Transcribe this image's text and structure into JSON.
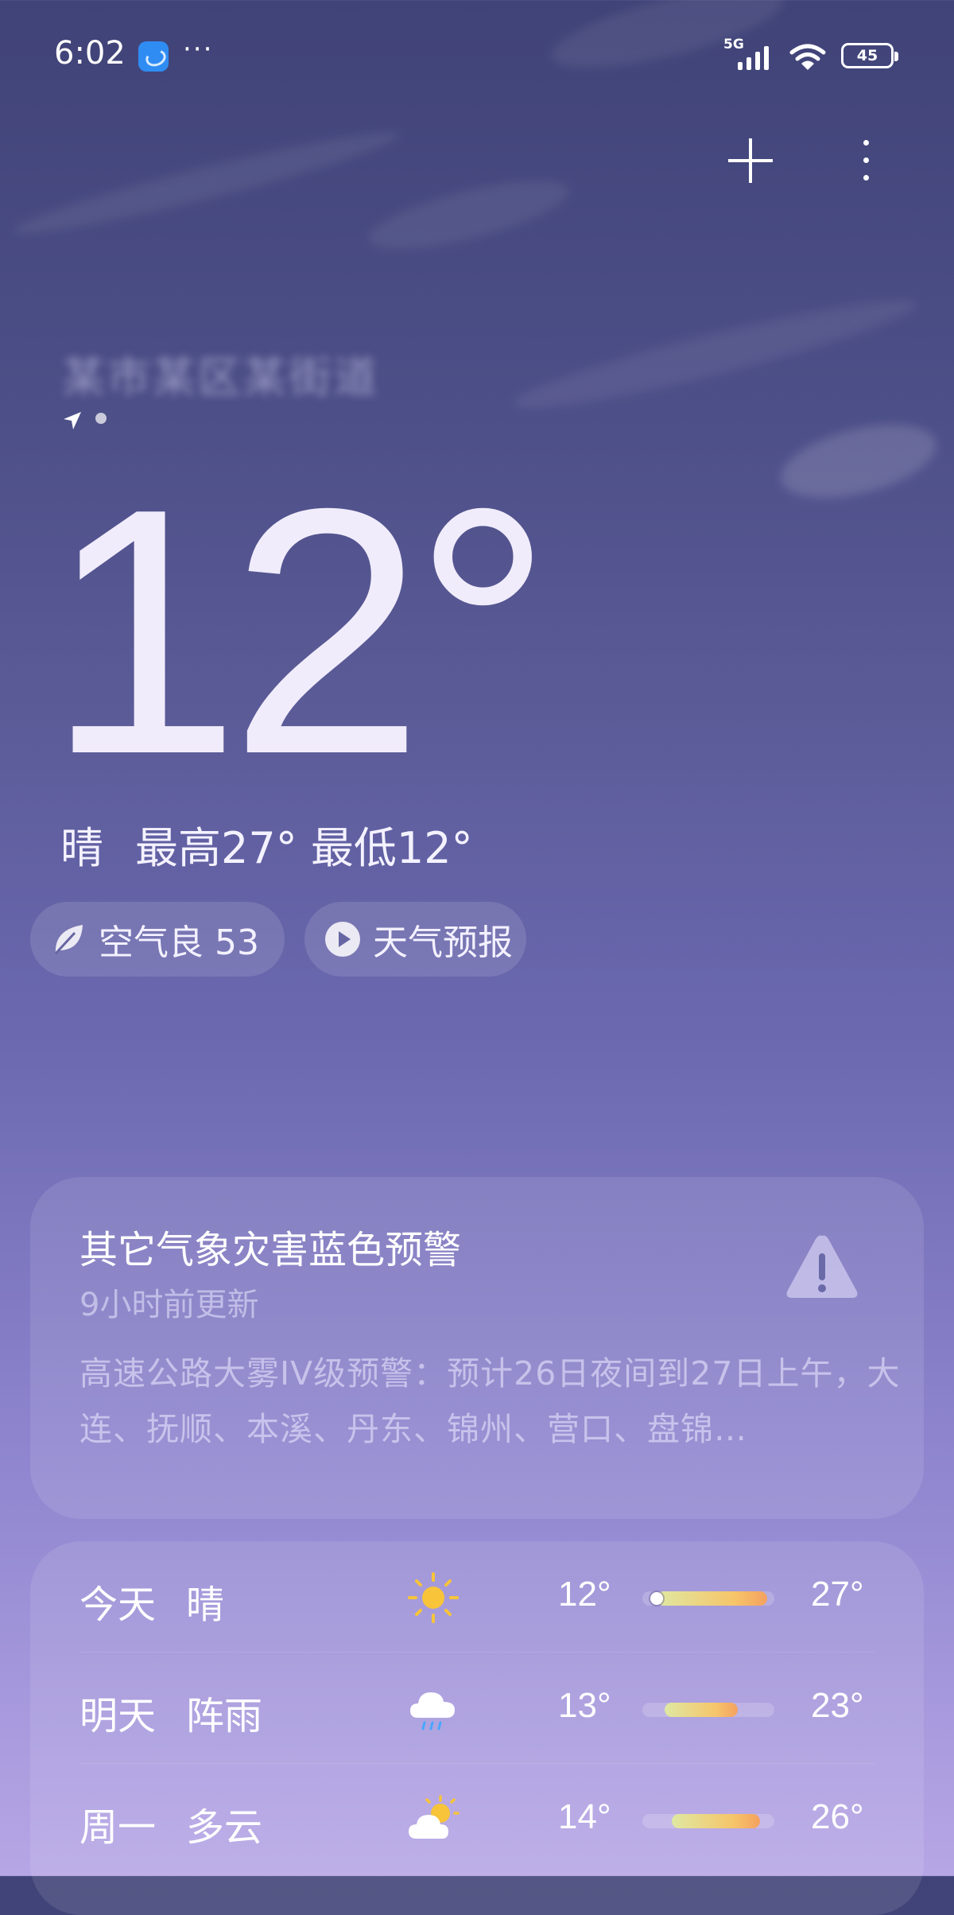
{
  "status_bar": {
    "time": "6:02",
    "app_icon": "weather-app-icon",
    "more": "···",
    "network": "5G",
    "battery": "45"
  },
  "header": {
    "add_icon": "plus-icon",
    "menu_icon": "vertical-ellipsis-icon"
  },
  "location": {
    "name": "某市某区某街道",
    "indicator_icon": "location-arrow-icon"
  },
  "current": {
    "temperature": "12°",
    "condition": "晴",
    "high_label": "最高27°",
    "low_label": "最低12°"
  },
  "chips": {
    "aqi": "空气良 53",
    "aqi_icon": "leaf-icon",
    "forecast": "天气预报",
    "forecast_icon": "play-icon"
  },
  "alert": {
    "title": "其它气象灾害蓝色预警",
    "updated": "9小时前更新",
    "text": "高速公路大雾IV级预警：预计26日夜间到27日上午，大连、抚顺、本溪、丹东、锦州、营口、盘锦…",
    "icon": "warning-triangle-icon"
  },
  "forecast": [
    {
      "day": "今天",
      "condition": "晴",
      "icon": "sun-icon",
      "low": "12°",
      "high": "27°",
      "low_val": 12,
      "high_val": 27,
      "now_val": 12
    },
    {
      "day": "明天",
      "condition": "阵雨",
      "icon": "rain-cloud-icon",
      "low": "13°",
      "high": "23°",
      "low_val": 13,
      "high_val": 23
    },
    {
      "day": "周一",
      "condition": "多云",
      "icon": "partly-cloudy-icon",
      "low": "14°",
      "high": "26°",
      "low_val": 14,
      "high_val": 26
    }
  ],
  "colors": {
    "accent_warm": "#f6c56a",
    "accent_cool": "#dfe8a2",
    "sun": "#f7c43a"
  }
}
